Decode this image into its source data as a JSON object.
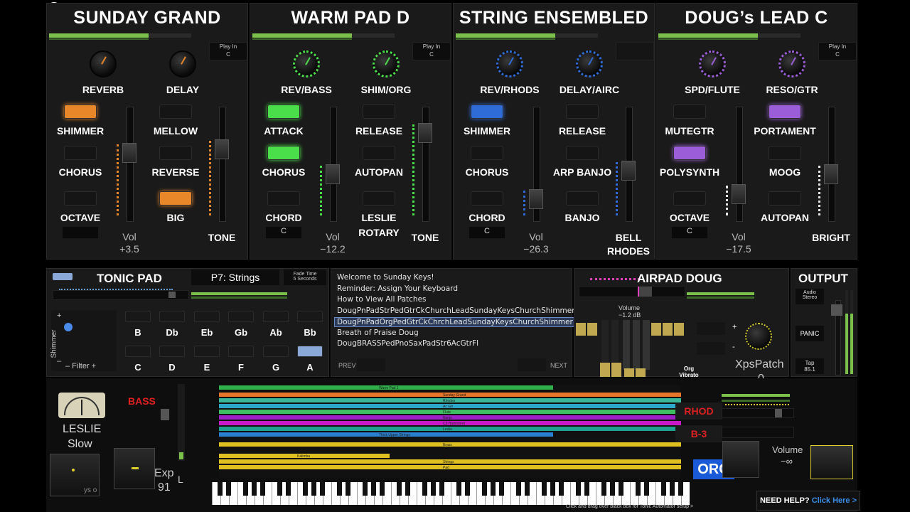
{
  "colors": {
    "orange": "#e8862a",
    "green": "#4ade4a",
    "blue": "#2f6cd8",
    "purple": "#9b5ed8",
    "level": "#7cc04c",
    "help_link": "#3a8ee8"
  },
  "close_icon": "close-icon",
  "panels": [
    {
      "title": "SUNDAY GRAND",
      "play_in": {
        "label": "Play In",
        "key": "C"
      },
      "knobs": [
        "REVERB",
        "DELAY"
      ],
      "buttons_left": [
        "SHIMMER",
        "CHORUS",
        "OCTAVE"
      ],
      "buttons_right": [
        "MELLOW",
        "REVERSE",
        "BIG"
      ],
      "vol_label": "Vol",
      "vol_value": "+3.5",
      "fader_right_label": "TONE",
      "key_box": ""
    },
    {
      "title": "WARM PAD D",
      "play_in": {
        "label": "Play In",
        "key": "C"
      },
      "knobs": [
        "REV/BASS",
        "SHIM/ORG"
      ],
      "buttons_left": [
        "ATTACK",
        "CHORUS",
        "CHORD"
      ],
      "buttons_right": [
        "RELEASE",
        "AUTOPAN",
        "LESLIE",
        "ROTARY"
      ],
      "vol_label": "Vol",
      "vol_value": "−12.2",
      "fader_right_label": "TONE",
      "key_box": "C"
    },
    {
      "title": "STRING ENSEMBLED",
      "play_in": {
        "label": "",
        "key": ""
      },
      "knobs": [
        "REV/RHODS",
        "DELAY/AIRC"
      ],
      "buttons_left": [
        "SHIMMER",
        "CHORUS",
        "CHORD"
      ],
      "buttons_right": [
        "RELEASE",
        "ARP BANJO",
        "BANJO"
      ],
      "vol_label": "Vol",
      "vol_value": "−26.3",
      "fader_right_label": "BELL",
      "fader_right_label2": "RHODES",
      "key_box": "C"
    },
    {
      "title": "DOUG’s LEAD C",
      "play_in": {
        "label": "Play In",
        "key": "C"
      },
      "knobs": [
        "SPD/FLUTE",
        "RESO/GTR"
      ],
      "buttons_left": [
        "MUTEGTR",
        "POLYSYNTH",
        "OCTAVE"
      ],
      "buttons_right": [
        "PORTAMENT",
        "MOOG",
        "AUTOPAN"
      ],
      "vol_label": "Vol",
      "vol_value": "−17.5",
      "fader_right_label": "BRIGHT",
      "key_box": "C"
    }
  ],
  "tonic": {
    "title": "TONIC PAD",
    "patch": "P7: Strings",
    "fade_label": "Fade Time",
    "fade_value": "5 Seconds",
    "shimmer_label": "Shimmer",
    "plus": "+",
    "minus": "–",
    "filter_label": "– Filter +",
    "notes_top": [
      "B",
      "Db",
      "Eb",
      "Gb",
      "Ab",
      "Bb"
    ],
    "notes_bottom": [
      "C",
      "D",
      "E",
      "F",
      "G",
      "A"
    ]
  },
  "library": {
    "items": [
      "Welcome to Sunday Keys!",
      "Reminder: Assign Your Keyboard",
      "How to View All Patches",
      "DougPnPadStrPedGtrCkChurchLeadSundayKeysChurchShimmer",
      "DougPnPadOrgPedGtrCkChrchLeadSundayKeysChurchShimmer",
      "Breath of Praise Doug",
      "DougBRASSPedPnoSaxPadStr6AcGtrFl"
    ],
    "selected": 4,
    "prev": "PREV",
    "next": "NEXT"
  },
  "airpad": {
    "title": "AIRPAD DOUG",
    "volume_label": "Volume",
    "volume_value": "−1.2 dB",
    "org_vibrato": "Org\nVibrato",
    "xps_label": "XpsPatch",
    "xps_value": "0",
    "plus": "+",
    "minus": "-"
  },
  "output": {
    "title": "OUTPUT",
    "audio_label": "Audio",
    "audio_value": "Stereo",
    "panic": "PANIC",
    "tap_label": "Tap",
    "tap_value": "85.1"
  },
  "bottom": {
    "leslie": "LESLIE",
    "slow": "Slow",
    "bass": "BASS",
    "exp_label": "Exp",
    "exp_value": "91",
    "l_label": "L",
    "rhod": "RHOD",
    "b3": "B-3",
    "org": "ORG",
    "volume_label": "Volume",
    "volume_value": "−∞",
    "help": "NEED HELP?",
    "help_link": "Click Here >",
    "hint": "Click and drag over black box for Tonic Automator setup >",
    "logo_frag": "ys o"
  },
  "tracks": [
    {
      "label": "Warm Pad 1",
      "color": "#2fb04a"
    },
    {
      "label": "Sunday Grand",
      "color": "#e8762a"
    },
    {
      "label": "Rhodes",
      "color": "#3bb89a"
    },
    {
      "label": "Ac Gtr",
      "color": "#2ea8c8"
    },
    {
      "label": "Flute",
      "color": "#3fc060"
    },
    {
      "label": "Banjo",
      "color": "#a020c8"
    },
    {
      "label": "C3 Hammond",
      "color": "#c818c8"
    },
    {
      "label": "Leslie",
      "color": "#20a090"
    },
    {
      "label": "Thick Upper Strings",
      "color": "#2a80d0"
    },
    {
      "label": "Brass",
      "color": "#e0c020"
    },
    {
      "label": "Kalimba",
      "color": "#e0c020"
    },
    {
      "label": "Strings",
      "color": "#e0c020"
    },
    {
      "label": "Pad",
      "color": "#e0c020"
    }
  ]
}
